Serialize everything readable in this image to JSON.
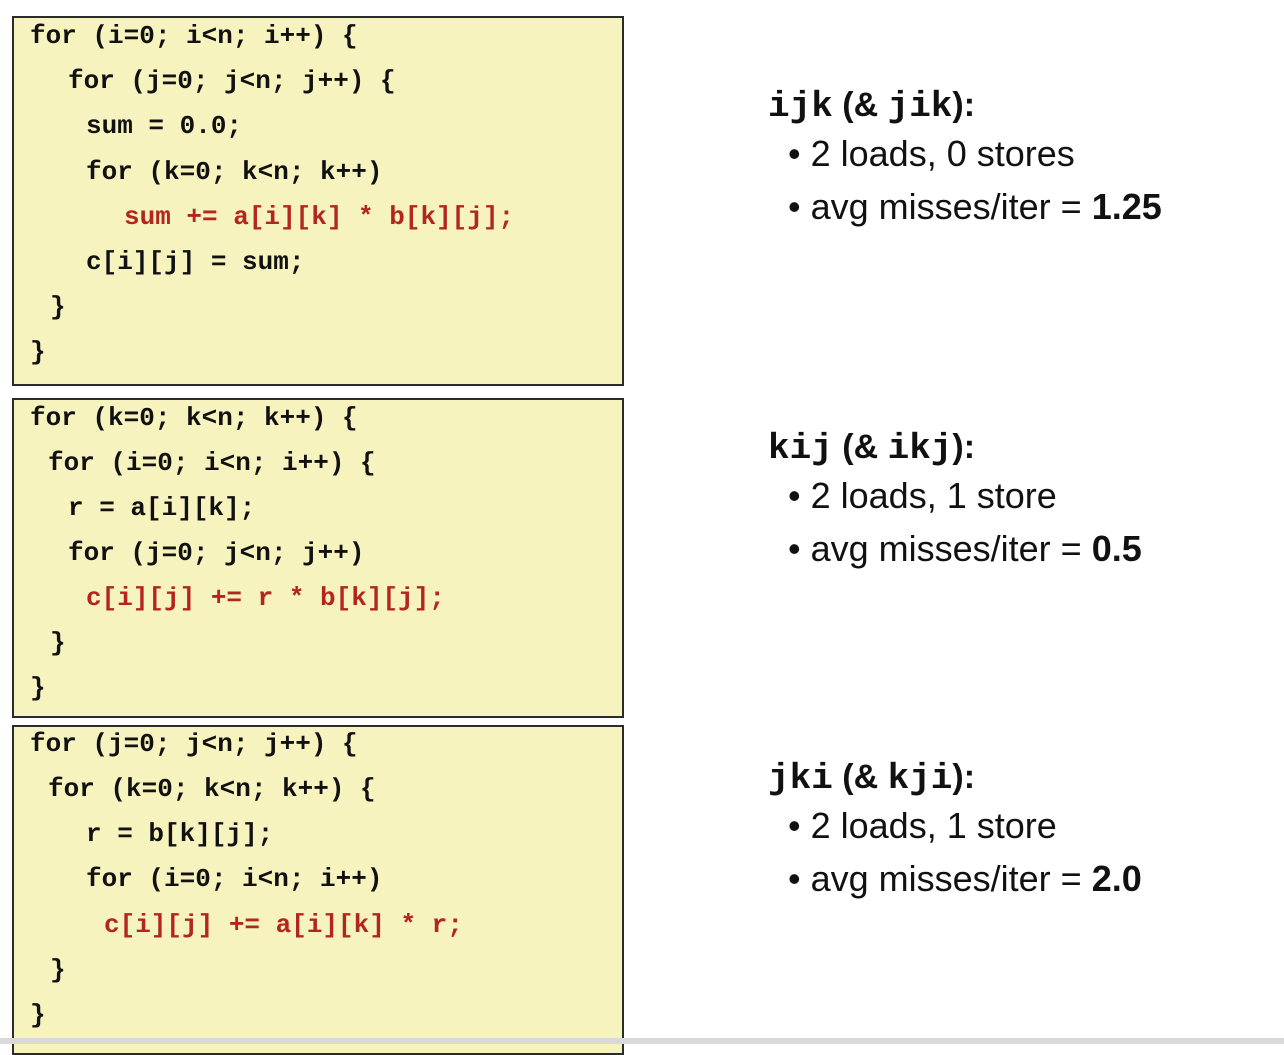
{
  "blocks": [
    {
      "lines": [
        {
          "text": "for (i=0; i<n; i++) {",
          "indent": 0,
          "highlight": false
        },
        {
          "text": "for (j=0; j<n; j++) {",
          "indent": 2,
          "highlight": false
        },
        {
          "text": "sum = 0.0;",
          "indent": 3,
          "highlight": false
        },
        {
          "text": "for (k=0; k<n; k++)",
          "indent": 3,
          "highlight": false
        },
        {
          "text": "sum += a[i][k] * b[k][j];",
          "indent": 5,
          "highlight": true
        },
        {
          "text": "c[i][j] = sum;",
          "indent": 3,
          "highlight": false
        },
        {
          "text": "}",
          "indent": 1,
          "highlight": false
        },
        {
          "text": "}",
          "indent": 0,
          "highlight": false
        }
      ],
      "summary": {
        "title_mono": "ijk",
        "title_rest": " (& ",
        "title_mono2": "jik",
        "title_end": "):",
        "bullet1": "2 loads, 0 stores",
        "bullet2_prefix": "avg misses/iter = ",
        "bullet2_value": "1.25"
      }
    },
    {
      "lines": [
        {
          "text": "for (k=0; k<n; k++) {",
          "indent": 0,
          "highlight": false
        },
        {
          "text": "for (i=0; i<n; i++) {",
          "indent": 1,
          "highlight": false
        },
        {
          "text": "r = a[i][k];",
          "indent": 2,
          "highlight": false
        },
        {
          "text": "for (j=0; j<n; j++)",
          "indent": 2,
          "highlight": false
        },
        {
          "text": "c[i][j] += r * b[k][j];",
          "indent": 3,
          "highlight": true
        },
        {
          "text": "}",
          "indent": 1,
          "highlight": false
        },
        {
          "text": "}",
          "indent": 0,
          "highlight": false
        }
      ],
      "summary": {
        "title_mono": "kij",
        "title_rest": " (& ",
        "title_mono2": "ikj",
        "title_end": "):",
        "bullet1": "2 loads, 1 store",
        "bullet2_prefix": "avg misses/iter = ",
        "bullet2_value": "0.5"
      }
    },
    {
      "lines": [
        {
          "text": "for (j=0; j<n; j++) {",
          "indent": 0,
          "highlight": false
        },
        {
          "text": "for (k=0; k<n; k++) {",
          "indent": 1,
          "highlight": false
        },
        {
          "text": "r = b[k][j];",
          "indent": 3,
          "highlight": false
        },
        {
          "text": "for (i=0; i<n; i++)",
          "indent": 3,
          "highlight": false
        },
        {
          "text": "c[i][j] += a[i][k] * r;",
          "indent": 4,
          "highlight": true
        },
        {
          "text": "}",
          "indent": 1,
          "highlight": false
        },
        {
          "text": "}",
          "indent": 0,
          "highlight": false
        }
      ],
      "summary": {
        "title_mono": "jki",
        "title_rest": " (& ",
        "title_mono2": "kji",
        "title_end": "):",
        "bullet1": "2 loads, 1 store",
        "bullet2_prefix": "avg misses/iter = ",
        "bullet2_value": "2.0"
      }
    }
  ],
  "colors": {
    "box_bg": "#f6f3bf",
    "box_border": "#2b2b2b",
    "highlight_text": "#b3261e",
    "text": "#111111"
  }
}
